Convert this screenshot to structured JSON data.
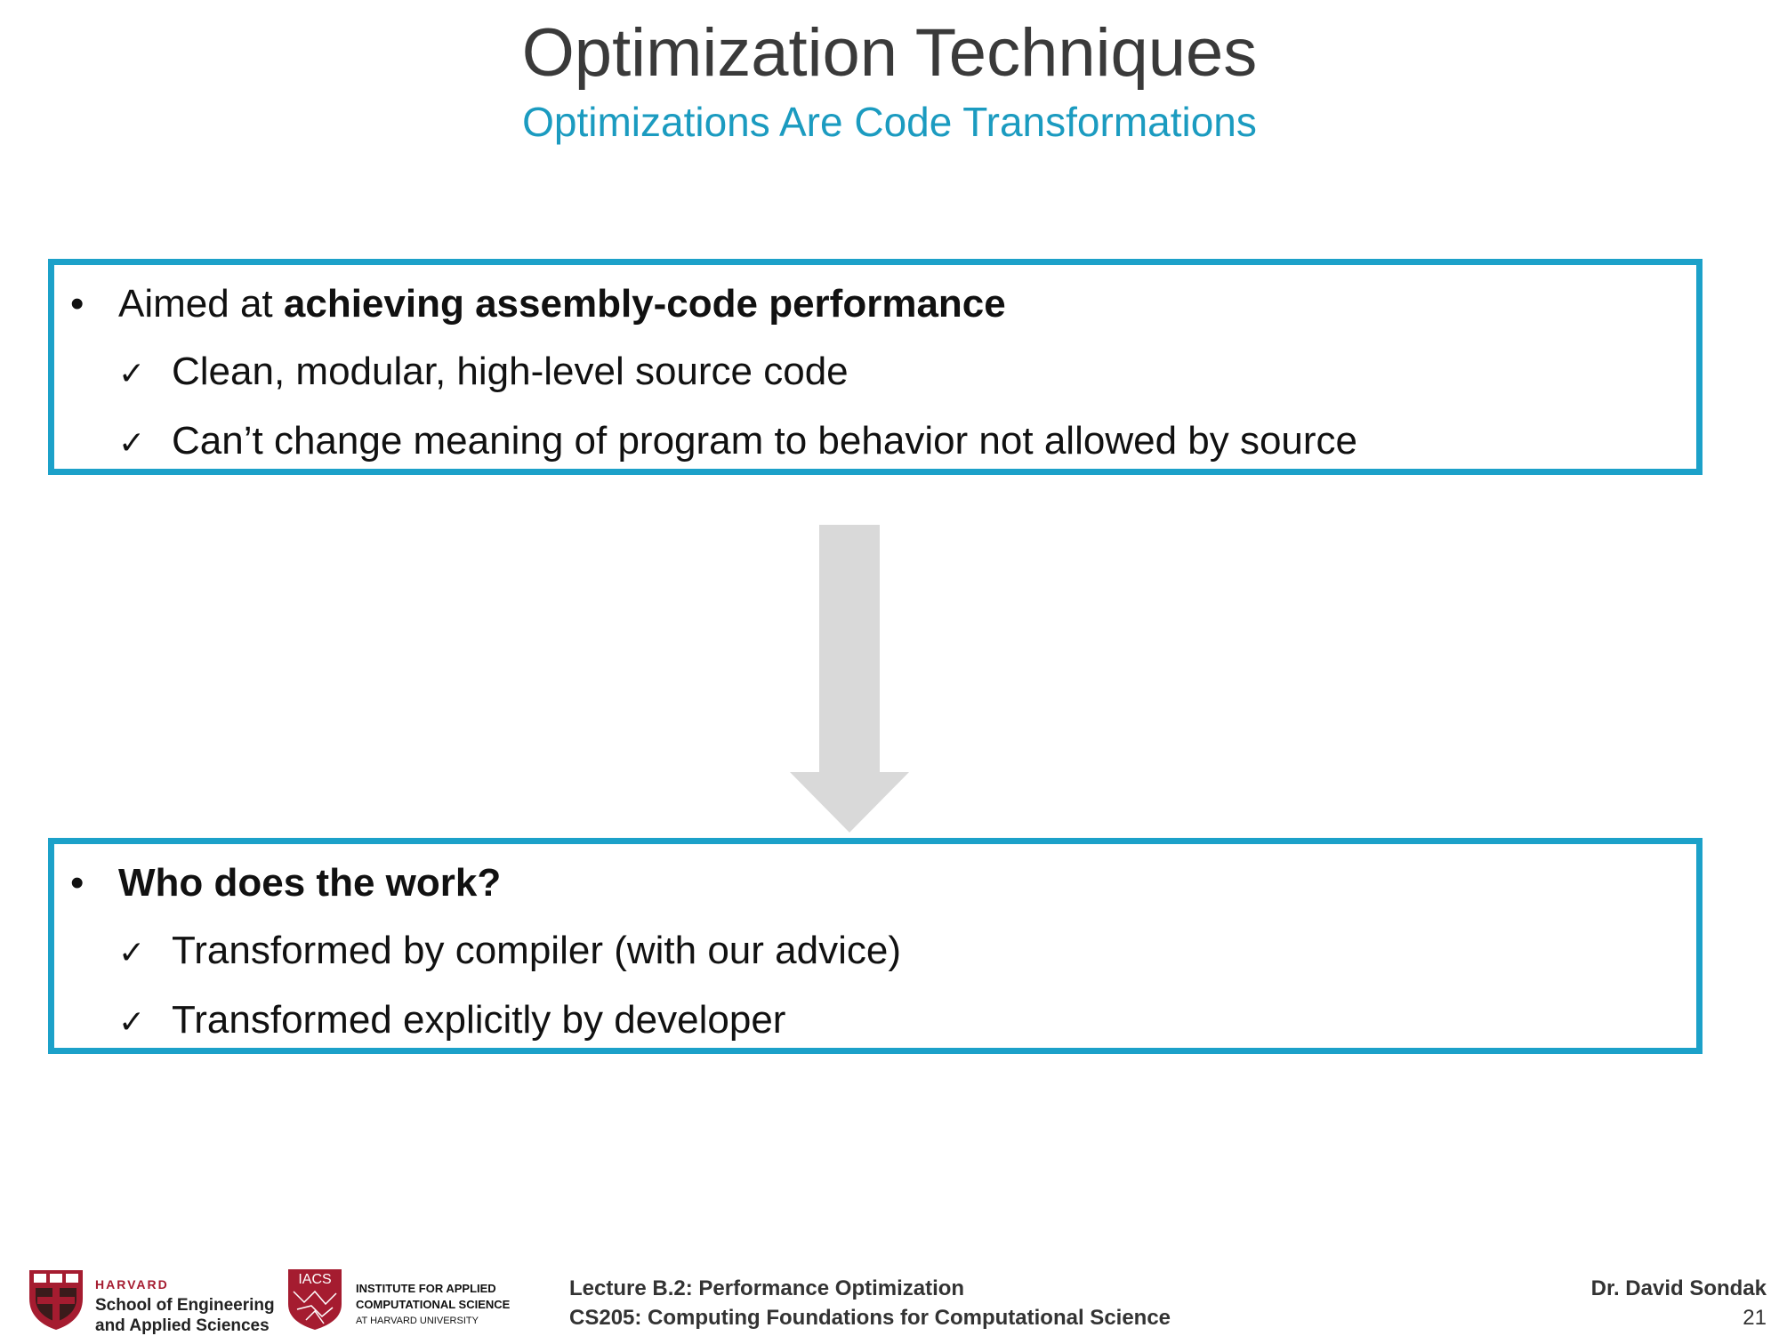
{
  "header": {
    "title": "Optimization Techniques",
    "subtitle": "Optimizations Are Code Transformations"
  },
  "box_top": {
    "bullet_prefix": "Aimed at ",
    "bullet_bold": "achieving assembly-code performance",
    "checks": [
      "Clean, modular, high-level source code",
      "Can’t change meaning of program to behavior not allowed by source"
    ]
  },
  "box_bottom": {
    "bullet_bold": "Who does the work?",
    "checks": [
      "Transformed by compiler (with our advice)",
      "Transformed explicitly by developer"
    ]
  },
  "symbols": {
    "bullet": "•",
    "check": "✓"
  },
  "colors": {
    "accent": "#1ca1c9",
    "subtitle": "#1b9bc0",
    "arrow": "#d9d9d9",
    "harvard_crimson": "#a51c30"
  },
  "footer": {
    "seas_logo": {
      "line1": "HARVARD",
      "line2": "School of Engineering",
      "line3": "and Applied Sciences"
    },
    "iacs_logo": {
      "badge": "IACS",
      "line1": "INSTITUTE FOR APPLIED",
      "line2": "COMPUTATIONAL SCIENCE",
      "line3": "AT HARVARD UNIVERSITY"
    },
    "lecture": "Lecture B.2: Performance Optimization",
    "course": "CS205: Computing Foundations for Computational Science",
    "author": "Dr. David Sondak",
    "page_number": "21"
  }
}
